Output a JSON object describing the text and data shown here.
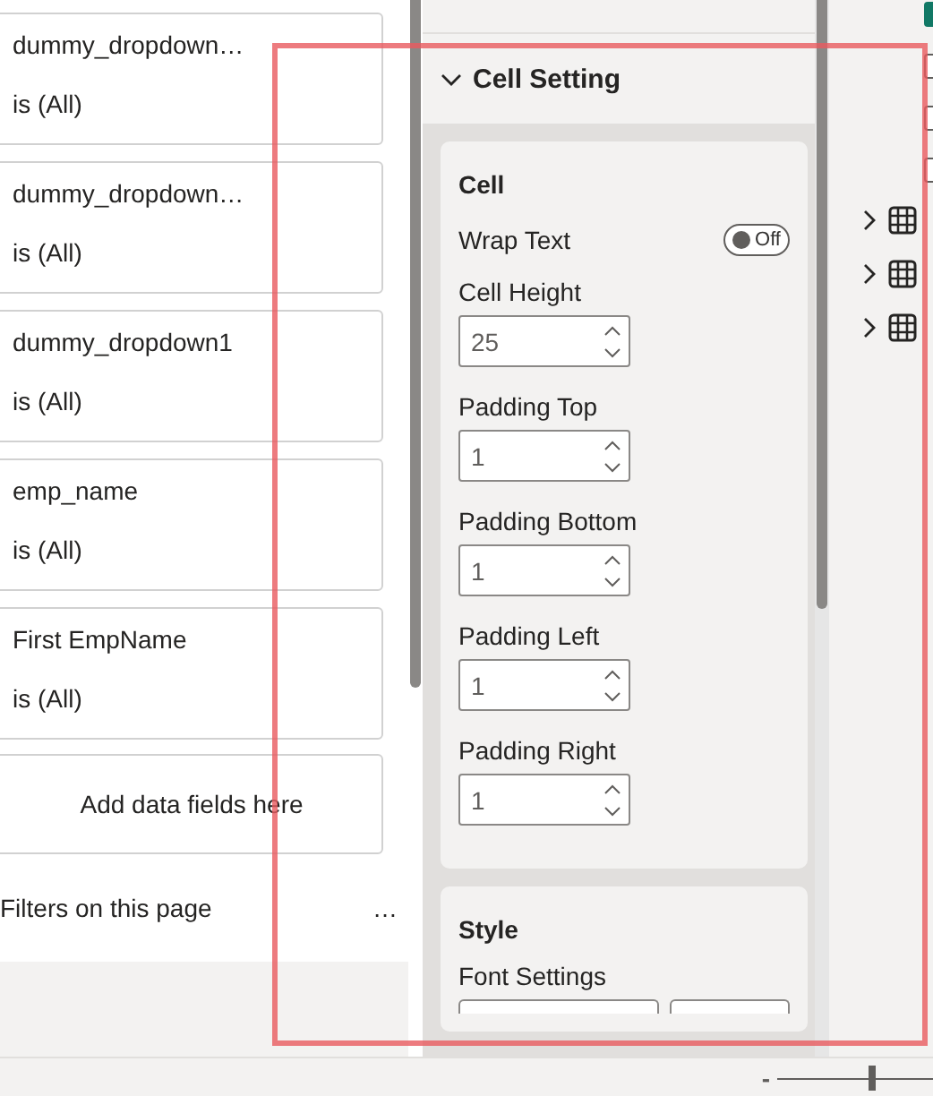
{
  "filters_pane": {
    "filters": [
      {
        "field": "dummy_dropdown…",
        "condition": "is (All)"
      },
      {
        "field": "dummy_dropdown…",
        "condition": "is (All)"
      },
      {
        "field": "dummy_dropdown1",
        "condition": "is (All)"
      },
      {
        "field": "emp_name",
        "condition": "is (All)"
      },
      {
        "field": "First EmpName",
        "condition": "is (All)"
      }
    ],
    "add_fields": "Add data fields here",
    "section_label": "Filters on this page",
    "more": "…"
  },
  "format_pane": {
    "section": {
      "title": "Cell Setting",
      "expanded": true
    },
    "cards": [
      {
        "title": "Cell",
        "settings": [
          {
            "kind": "toggle",
            "label": "Wrap Text",
            "on": false,
            "state_label": "Off"
          },
          {
            "kind": "spinner",
            "label": "Cell Height",
            "value": "25"
          },
          {
            "kind": "spinner",
            "label": "Padding Top",
            "value": "1"
          },
          {
            "kind": "spinner",
            "label": "Padding Bottom",
            "value": "1"
          },
          {
            "kind": "spinner",
            "label": "Padding Left",
            "value": "1"
          },
          {
            "kind": "spinner",
            "label": "Padding Right",
            "value": "1"
          }
        ]
      },
      {
        "title": "Style",
        "settings": [
          {
            "kind": "font_row",
            "label": "Font Settings"
          }
        ]
      }
    ]
  },
  "data_pane": {
    "checkboxes": [
      {
        "checked": true
      },
      {
        "checked": false
      },
      {
        "checked": false
      },
      {
        "checked": false
      }
    ],
    "tables": [
      {
        "expanded": false
      },
      {
        "expanded": false
      },
      {
        "expanded": false
      }
    ]
  },
  "status_bar": {
    "zoom_out": "-",
    "zoom": {
      "level": 0.6
    }
  }
}
